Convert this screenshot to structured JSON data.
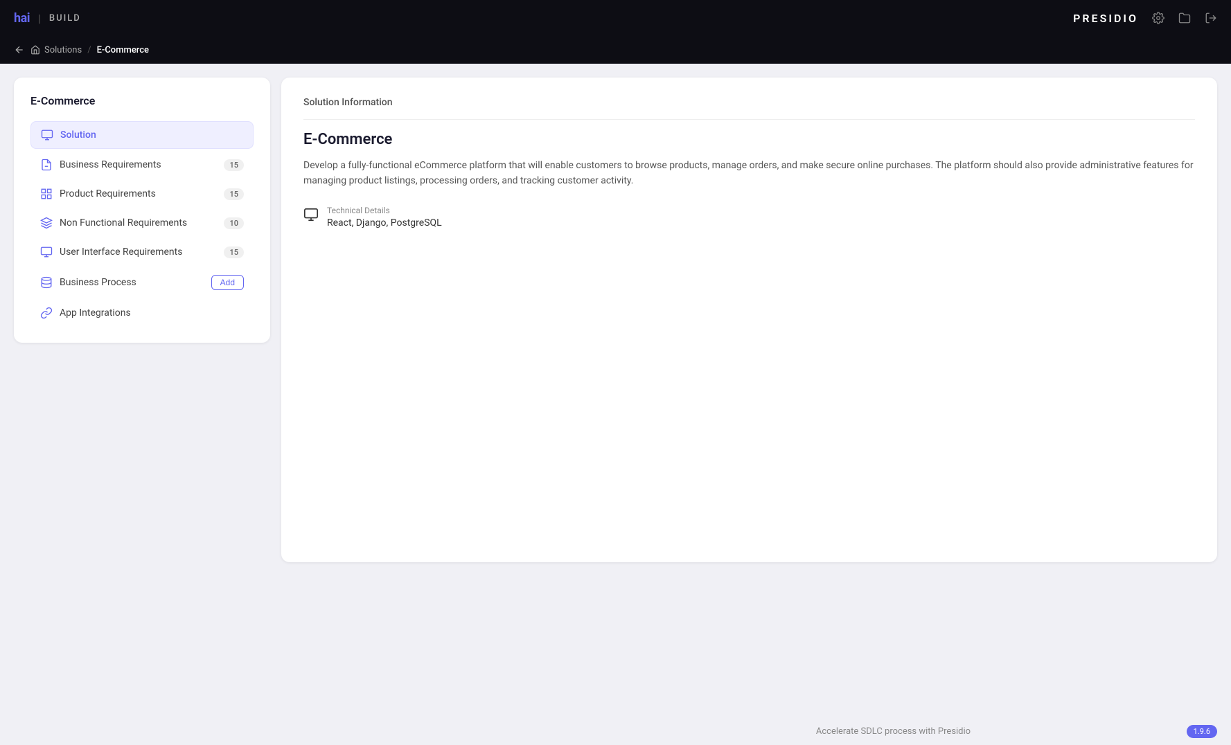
{
  "app": {
    "logo_hai": "hai",
    "logo_divider": "|",
    "logo_build": "BUILD",
    "presidio": "PRESIDIO"
  },
  "breadcrumb": {
    "back_label": "←",
    "home_label": "Solutions",
    "separator": "/",
    "current": "E-Commerce"
  },
  "left_panel": {
    "title": "E-Commerce",
    "nav_items": [
      {
        "id": "solution",
        "label": "Solution",
        "badge": null,
        "active": true
      },
      {
        "id": "business-requirements",
        "label": "Business Requirements",
        "badge": "15",
        "active": false
      },
      {
        "id": "product-requirements",
        "label": "Product Requirements",
        "badge": "15",
        "active": false
      },
      {
        "id": "non-functional-requirements",
        "label": "Non Functional Requirements",
        "badge": "10",
        "active": false
      },
      {
        "id": "user-interface-requirements",
        "label": "User Interface Requirements",
        "badge": "15",
        "active": false
      },
      {
        "id": "business-process",
        "label": "Business Process",
        "badge": null,
        "add_btn": "Add",
        "active": false
      },
      {
        "id": "app-integrations",
        "label": "App Integrations",
        "badge": null,
        "active": false
      }
    ]
  },
  "right_panel": {
    "section_title": "Solution Information",
    "solution_name": "E-Commerce",
    "description": "Develop a fully-functional eCommerce platform that will enable customers to browse products, manage orders, and make secure online purchases. The platform should also provide administrative features for managing product listings, processing orders, and tracking customer activity.",
    "tech_details_label": "Technical Details",
    "tech_details_value": "React, Django, PostgreSQL"
  },
  "footer": {
    "text": "Accelerate SDLC process with Presidio",
    "version": "1.9.6"
  },
  "icons": {
    "gear": "⚙",
    "folder": "🗂",
    "logout": "→"
  }
}
